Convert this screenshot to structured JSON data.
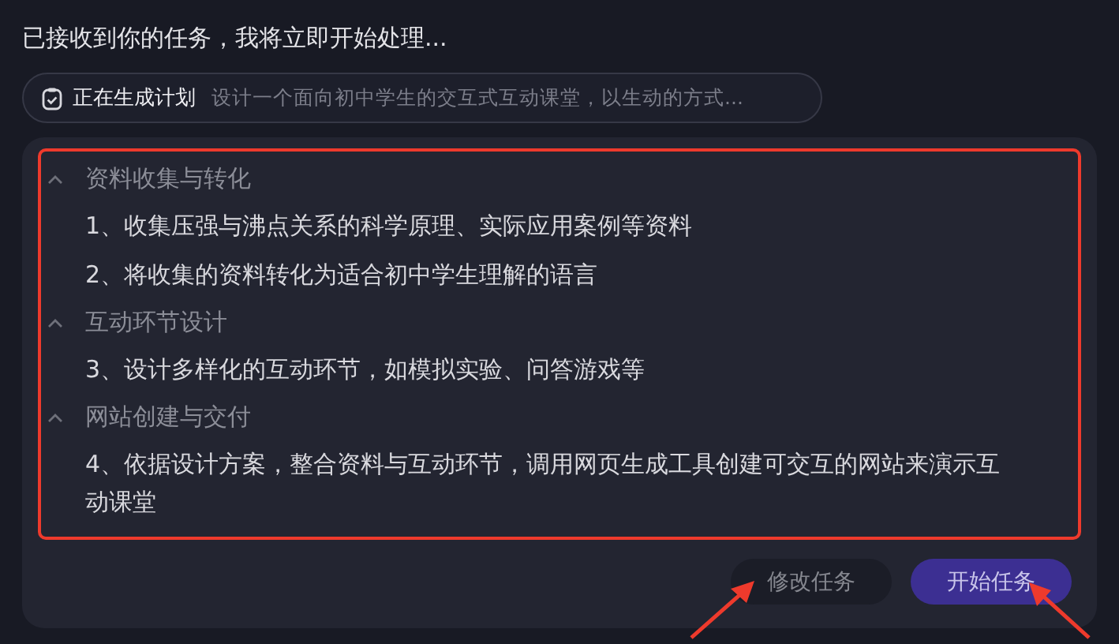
{
  "message": "已接收到你的任务，我将立即开始处理...",
  "status_pill": {
    "label": "正在生成计划",
    "summary": "设计一个面向初中学生的交互式互动课堂，以生动的方式..."
  },
  "plan": {
    "sections": [
      {
        "title": "资料收集与转化",
        "expanded": true,
        "steps": [
          "1、收集压强与沸点关系的科学原理、实际应用案例等资料",
          "2、将收集的资料转化为适合初中学生理解的语言"
        ]
      },
      {
        "title": "互动环节设计",
        "expanded": true,
        "steps": [
          "3、设计多样化的互动环节，如模拟实验、问答游戏等"
        ]
      },
      {
        "title": "网站创建与交付",
        "expanded": true,
        "steps": [
          "4、依据设计方案，整合资料与互动环节，调用网页生成工具创建可交互的网站来演示互动课堂"
        ]
      }
    ]
  },
  "buttons": [
    {
      "label": "修改任务",
      "kind": "secondary"
    },
    {
      "label": "开始任务",
      "kind": "primary"
    }
  ],
  "markup": {
    "color": "#ee3a2c"
  }
}
